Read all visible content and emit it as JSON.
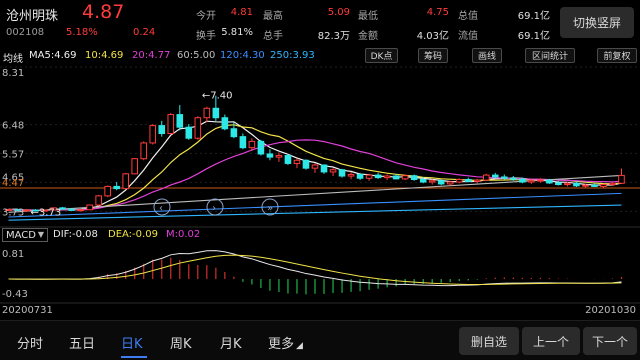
{
  "stock": {
    "name": "沧州明珠",
    "price": "4.87",
    "code": "002108",
    "change_pct": "5.18%",
    "change_abs": "0.24"
  },
  "quote": {
    "open_label": "今开",
    "open": "4.81",
    "high_label": "最高",
    "high": "5.09",
    "low_label": "最低",
    "low": "4.75",
    "mktcap_label": "总值",
    "mktcap": "69.1亿",
    "turnover_label": "换手",
    "turnover": "5.81%",
    "volume_label": "总手",
    "volume": "82.3万",
    "amount_label": "金额",
    "amount": "4.03亿",
    "float_label": "流值",
    "float": "69.1亿"
  },
  "switch_button": "切换竖屏",
  "ma": {
    "label": "均线",
    "ma5": "MA5:4.69",
    "ma10": "10:4.69",
    "ma20": "20:4.77",
    "ma60": "60:5.00",
    "ma120": "120:4.30",
    "ma250": "250:3.93"
  },
  "toolbar": {
    "dk": "DK点",
    "chip": "筹码",
    "draw": "画线",
    "range": "区间统计",
    "adjust": "前复权"
  },
  "colors": {
    "up": "#ff3b3b",
    "down": "#2ee8e8",
    "ma5": "#f0f0f0",
    "ma10": "#f2e34a",
    "ma20": "#e040d8",
    "ma60": "#bdbdbd",
    "ma120": "#3a8fff",
    "ma250": "#2fb5ff",
    "accent": "#3f7df2"
  },
  "chart_data": {
    "type": "candlestick",
    "y_labels": [
      "8.31",
      "6.48",
      "5.57",
      "4.65",
      "4.47",
      "3.73"
    ],
    "current_price_line": "4.47",
    "high_marker": "7.40",
    "low_marker": "3.73",
    "candles": [
      [
        3.78,
        3.8,
        3.74,
        3.79
      ],
      [
        3.79,
        3.82,
        3.75,
        3.76
      ],
      [
        3.76,
        3.78,
        3.72,
        3.77
      ],
      [
        3.77,
        3.8,
        3.74,
        3.75
      ],
      [
        3.75,
        3.78,
        3.73,
        3.77
      ],
      [
        3.77,
        3.85,
        3.76,
        3.84
      ],
      [
        3.84,
        3.87,
        3.79,
        3.8
      ],
      [
        3.8,
        3.83,
        3.74,
        3.76
      ],
      [
        3.76,
        3.8,
        3.73,
        3.78
      ],
      [
        3.78,
        3.95,
        3.77,
        3.93
      ],
      [
        3.93,
        4.25,
        3.9,
        4.22
      ],
      [
        4.22,
        4.55,
        4.18,
        4.52
      ],
      [
        4.52,
        4.66,
        4.4,
        4.45
      ],
      [
        4.45,
        4.95,
        4.44,
        4.92
      ],
      [
        4.92,
        5.42,
        4.9,
        5.4
      ],
      [
        5.4,
        5.95,
        5.35,
        5.9
      ],
      [
        5.9,
        6.5,
        5.85,
        6.45
      ],
      [
        6.45,
        6.6,
        6.1,
        6.2
      ],
      [
        6.2,
        6.85,
        6.15,
        6.8
      ],
      [
        6.8,
        7.1,
        6.3,
        6.4
      ],
      [
        6.4,
        6.5,
        6.0,
        6.05
      ],
      [
        6.05,
        6.75,
        6.0,
        6.7
      ],
      [
        6.7,
        7.05,
        6.55,
        7.0
      ],
      [
        7.0,
        7.4,
        6.6,
        6.7
      ],
      [
        6.7,
        6.8,
        6.3,
        6.35
      ],
      [
        6.35,
        6.55,
        6.05,
        6.1
      ],
      [
        6.1,
        6.2,
        5.7,
        5.75
      ],
      [
        5.75,
        6.05,
        5.65,
        5.95
      ],
      [
        5.95,
        6.0,
        5.5,
        5.55
      ],
      [
        5.55,
        5.7,
        5.35,
        5.45
      ],
      [
        5.45,
        5.6,
        5.3,
        5.5
      ],
      [
        5.5,
        5.55,
        5.2,
        5.25
      ],
      [
        5.25,
        5.4,
        5.1,
        5.35
      ],
      [
        5.35,
        5.38,
        5.05,
        5.1
      ],
      [
        5.1,
        5.25,
        4.95,
        5.2
      ],
      [
        5.2,
        5.22,
        4.92,
        4.98
      ],
      [
        4.98,
        5.1,
        4.85,
        5.05
      ],
      [
        5.05,
        5.08,
        4.8,
        4.85
      ],
      [
        4.85,
        4.98,
        4.75,
        4.9
      ],
      [
        4.9,
        4.95,
        4.72,
        4.78
      ],
      [
        4.78,
        4.92,
        4.7,
        4.88
      ],
      [
        4.88,
        4.95,
        4.76,
        4.8
      ],
      [
        4.8,
        4.9,
        4.72,
        4.85
      ],
      [
        4.85,
        4.92,
        4.74,
        4.76
      ],
      [
        4.76,
        4.9,
        4.72,
        4.86
      ],
      [
        4.86,
        4.9,
        4.7,
        4.74
      ],
      [
        4.74,
        4.82,
        4.62,
        4.66
      ],
      [
        4.66,
        4.75,
        4.58,
        4.7
      ],
      [
        4.7,
        4.74,
        4.56,
        4.6
      ],
      [
        4.6,
        4.7,
        4.55,
        4.66
      ],
      [
        4.66,
        4.78,
        4.62,
        4.74
      ],
      [
        4.74,
        4.8,
        4.65,
        4.68
      ],
      [
        4.68,
        4.76,
        4.62,
        4.72
      ],
      [
        4.72,
        4.92,
        4.7,
        4.88
      ],
      [
        4.88,
        4.95,
        4.78,
        4.82
      ],
      [
        4.82,
        4.9,
        4.74,
        4.78
      ],
      [
        4.78,
        4.85,
        4.7,
        4.75
      ],
      [
        4.75,
        4.8,
        4.62,
        4.66
      ],
      [
        4.66,
        4.74,
        4.6,
        4.7
      ],
      [
        4.7,
        4.78,
        4.64,
        4.72
      ],
      [
        4.72,
        4.76,
        4.6,
        4.63
      ],
      [
        4.63,
        4.7,
        4.55,
        4.58
      ],
      [
        4.58,
        4.66,
        4.52,
        4.62
      ],
      [
        4.62,
        4.68,
        4.5,
        4.54
      ],
      [
        4.54,
        4.6,
        4.48,
        4.56
      ],
      [
        4.56,
        4.62,
        4.5,
        4.52
      ],
      [
        4.52,
        4.6,
        4.48,
        4.58
      ],
      [
        4.58,
        4.66,
        4.54,
        4.62
      ],
      [
        4.62,
        5.09,
        4.6,
        4.87
      ]
    ],
    "ma60_line": [
      [
        0,
        3.7
      ],
      [
        68,
        4.87
      ]
    ],
    "ma120_line": [
      [
        0,
        3.55
      ],
      [
        68,
        4.3
      ]
    ],
    "ma250_line": [
      [
        0,
        3.45
      ],
      [
        68,
        3.93
      ]
    ],
    "macd": {
      "label": "MACD",
      "dif": "DIF:-0.08",
      "dea": "DEA:-0.09",
      "m": "M:0.02",
      "y_top": "0.81",
      "y_bottom": "-0.43"
    }
  },
  "dates": {
    "start": "20200731",
    "end": "20201030"
  },
  "bottom": {
    "tabs": [
      "分时",
      "五日",
      "日K",
      "周K",
      "月K",
      "更多"
    ],
    "active_tab": 2,
    "delete_btn": "删自选",
    "prev_btn": "上一个",
    "next_btn": "下一个"
  }
}
